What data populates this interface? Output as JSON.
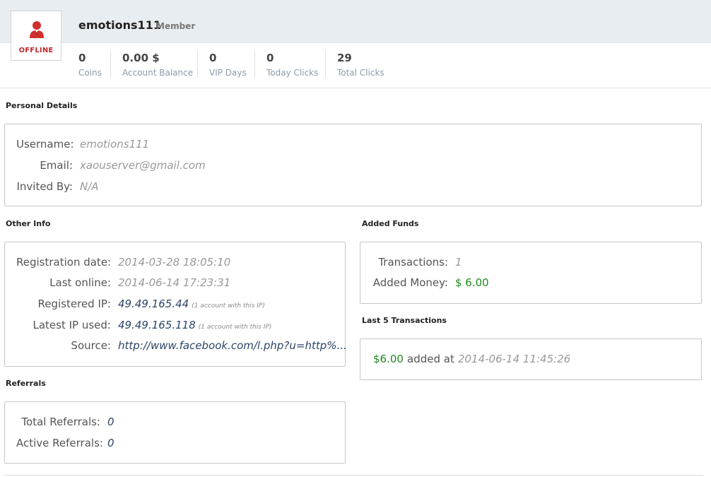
{
  "profile": {
    "username": "emotions111",
    "role": "Member",
    "status": "OFFLINE",
    "avatar_icon": "user-icon",
    "status_color": "#c0282a"
  },
  "stats": [
    {
      "value": "0",
      "label": "Coins"
    },
    {
      "value": "0.00 $",
      "label": "Account Balance"
    },
    {
      "value": "0",
      "label": "VIP Days"
    },
    {
      "value": "0",
      "label": "Today Clicks"
    },
    {
      "value": "29",
      "label": "Total Clicks"
    }
  ],
  "personal_details": {
    "title": "Personal Details",
    "username_label": "Username:",
    "username_value": "emotions111",
    "email_label": "Email:",
    "email_value": "xaouserver@gmail.com",
    "invited_label": "Invited By:",
    "invited_value": "N/A"
  },
  "other_info": {
    "title": "Other Info",
    "reg_date_label": "Registration date:",
    "reg_date_value": "2014-03-28 18:05:10",
    "last_online_label": "Last online:",
    "last_online_value": "2014-06-14 17:23:31",
    "reg_ip_label": "Registered IP:",
    "reg_ip_value": "49.49.165.44",
    "reg_ip_note": "(1 account with this IP)",
    "latest_ip_label": "Latest IP used:",
    "latest_ip_value": "49.49.165.118",
    "latest_ip_note": "(1 account with this IP)",
    "source_label": "Source:",
    "source_value": "http://www.facebook.com/l.php?u=http%..."
  },
  "referrals": {
    "title": "Referrals",
    "total_label": "Total Referrals:",
    "total_value": "0",
    "active_label": "Active Referrals:",
    "active_value": "0"
  },
  "added_funds": {
    "title": "Added Funds",
    "transactions_label": "Transactions:",
    "transactions_value": "1",
    "money_label": "Added Money:",
    "money_value": "$ 6.00"
  },
  "last_transactions": {
    "title": "Last 5 Transactions",
    "items": [
      {
        "amount": "$6.00",
        "text": "added at",
        "date": "2014-06-14 11:45:26"
      }
    ]
  },
  "colors": {
    "money_green": "#1f8a1f",
    "ip_blue": "#2c4566"
  }
}
